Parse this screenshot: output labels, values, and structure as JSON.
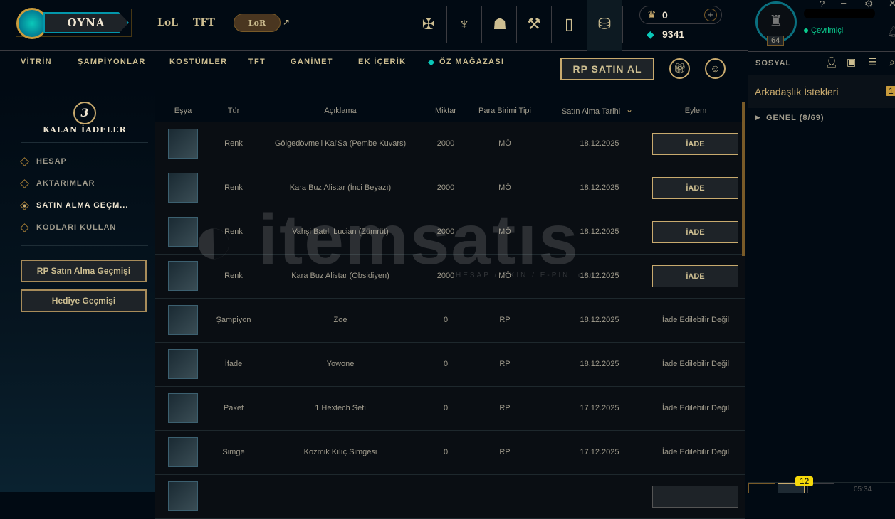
{
  "header": {
    "play": "OYNA",
    "game_tabs": [
      "LoL",
      "TFT"
    ],
    "lor": "LoR",
    "rp": "0",
    "be": "9341",
    "level": "64",
    "status": "Çevrimiçi",
    "help": "?",
    "minimize": "–",
    "settings": "⚙",
    "close": "✕"
  },
  "store_nav": [
    "VİTRİN",
    "ŞAMPİYONLAR",
    "KOSTÜMLER",
    "TFT",
    "GANİMET",
    "EK İÇERİK",
    "ÖZ MAĞAZASI"
  ],
  "rp_button": "RP SATIN AL",
  "sidebar": {
    "remaining_count": "3",
    "remaining_label": "KALAN İADELER",
    "items": [
      "HESAP",
      "AKTARIMLAR",
      "SATIN ALMA GEÇM...",
      "KODLARI KULLAN"
    ],
    "active_index": 2,
    "buttons": [
      "RP Satın Alma Geçmişi",
      "Hediye Geçmişi"
    ]
  },
  "table": {
    "headers": [
      "Eşya",
      "Tür",
      "Açıklama",
      "Miktar",
      "Para Birimi Tipi",
      "Satın Alma Tarihi",
      "Eylem"
    ],
    "rows": [
      {
        "type": "Renk",
        "desc": "Gölgedövmeli Kai'Sa (Pembe Kuvars)",
        "amount": "2000",
        "currency": "MÖ",
        "date": "18.12.2025",
        "action": "İADE"
      },
      {
        "type": "Renk",
        "desc": "Kara Buz Alistar (İnci Beyazı)",
        "amount": "2000",
        "currency": "MÖ",
        "date": "18.12.2025",
        "action": "İADE"
      },
      {
        "type": "Renk",
        "desc": "Vahşi Batılı Lucian (Zümrüt)",
        "amount": "2000",
        "currency": "MÖ",
        "date": "18.12.2025",
        "action": "İADE"
      },
      {
        "type": "Renk",
        "desc": "Kara Buz Alistar (Obsidiyen)",
        "amount": "2000",
        "currency": "MÖ",
        "date": "18.12.2025",
        "action": "İADE"
      },
      {
        "type": "Şampiyon",
        "desc": "Zoe",
        "amount": "0",
        "currency": "RP",
        "date": "18.12.2025",
        "action": "İade Edilebilir Değil"
      },
      {
        "type": "İfade",
        "desc": "Yowone",
        "amount": "0",
        "currency": "RP",
        "date": "18.12.2025",
        "action": "İade Edilebilir Değil"
      },
      {
        "type": "Paket",
        "desc": "1 Hextech Seti",
        "amount": "0",
        "currency": "RP",
        "date": "17.12.2025",
        "action": "İade Edilebilir Değil"
      },
      {
        "type": "Simge",
        "desc": "Kozmik Kılıç Simgesi",
        "amount": "0",
        "currency": "RP",
        "date": "17.12.2025",
        "action": "İade Edilebilir Değil"
      }
    ]
  },
  "social": {
    "title": "SOSYAL",
    "friend_requests": "Arkadaşlık İstekleri",
    "requests_count": "1",
    "group": "GENEL (8/69)",
    "notif_count": "12",
    "clock": "05:34"
  },
  "watermark": {
    "text": "itemsatis",
    "sub": "HESAP / SKIN / E-PIN .com"
  }
}
